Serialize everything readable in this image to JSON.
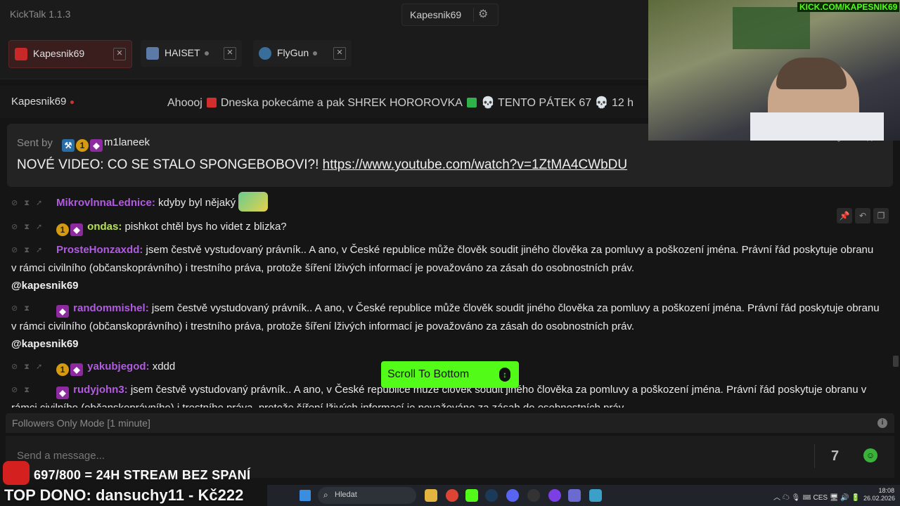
{
  "app": {
    "title": "KickTalk 1.1.3"
  },
  "user": {
    "name": "Kapesnik69"
  },
  "tabs": [
    {
      "name": "Kapesnik69",
      "active": true
    },
    {
      "name": "HAISET",
      "active": false
    },
    {
      "name": "FlyGun",
      "active": false
    }
  ],
  "channel": {
    "name": "Kapesnik69",
    "title_parts": [
      "Ahoooj",
      "Dneska pokecáme a pak SHREK HOROROVKA",
      "💀 TENTO PÁTEK 67 💀 12 h"
    ]
  },
  "pinned": {
    "sent_by_label": "Sent by",
    "sender": "m1laneek",
    "message_text": "NOVÉ VIDEO: CO SE STALO SPONGEBOBOVI?!",
    "link": "https://www.youtube.com/watch?v=1ZtMA4CWbDU"
  },
  "messages": [
    {
      "user": "MikrovlnnaLednice:",
      "text": "kdyby byl nějaký",
      "mention": ""
    },
    {
      "user": "ondas:",
      "text": "pishkot chtěl bys ho videt z blizka?",
      "mention": ""
    },
    {
      "user": "ProsteHonzaxdd:",
      "text": "jsem čestvě vystudovaný právník.. A ano, v České republice může člověk soudit jiného člověka za pomluvy a poškození jména. Právní řád poskytuje obranu v rámci civilního (občanskoprávního) i trestního práva, protože šíření lživých informací je považováno za zásah do osobnostních práv.",
      "mention": "@kapesnik69"
    },
    {
      "user": "randommishel:",
      "text": "jsem čestvě vystudovaný právník.. A ano, v České republice může člověk soudit jiného člověka za pomluvy a poškození jména. Právní řád poskytuje obranu v rámci civilního (občanskoprávního) i trestního práva, protože šíření lživých informací je považováno za zásah do osobnostních práv.",
      "mention": "@kapesnik69"
    },
    {
      "user": "yakubjegod:",
      "text": "xddd",
      "mention": ""
    },
    {
      "user": "rudyjohn3:",
      "text": "jsem čestvě vystudovaný právník.. A ano, v České republice může člověk soudit jiného člověka za pomluvy a poškození jména. Právní řád poskytuje obranu v rámci civilního (občanskoprávního) i trestního práva, protože šíření lživých informací je považováno za zásah do osobnostních práv.",
      "mention": ""
    }
  ],
  "scroll_button": {
    "label": "Scroll To Bottom"
  },
  "followers_mode": {
    "label": "Followers Only Mode [1 minute]"
  },
  "input": {
    "placeholder": "Send a message..."
  },
  "overlay": {
    "goal": "697/800 = 24H STREAM BEZ SPANÍ",
    "top_donor": "TOP DONO: dansuchy11 - Kč222",
    "kick_tag": "KICK.COM/KAPESNIK69"
  },
  "taskbar": {
    "search_placeholder": "Hledat",
    "language": "CES",
    "time": "18:08",
    "date": "26.02.2026"
  },
  "colors": {
    "accent": "#53fc18",
    "username": "#b15ce0",
    "live_dot": "#cc3333"
  }
}
